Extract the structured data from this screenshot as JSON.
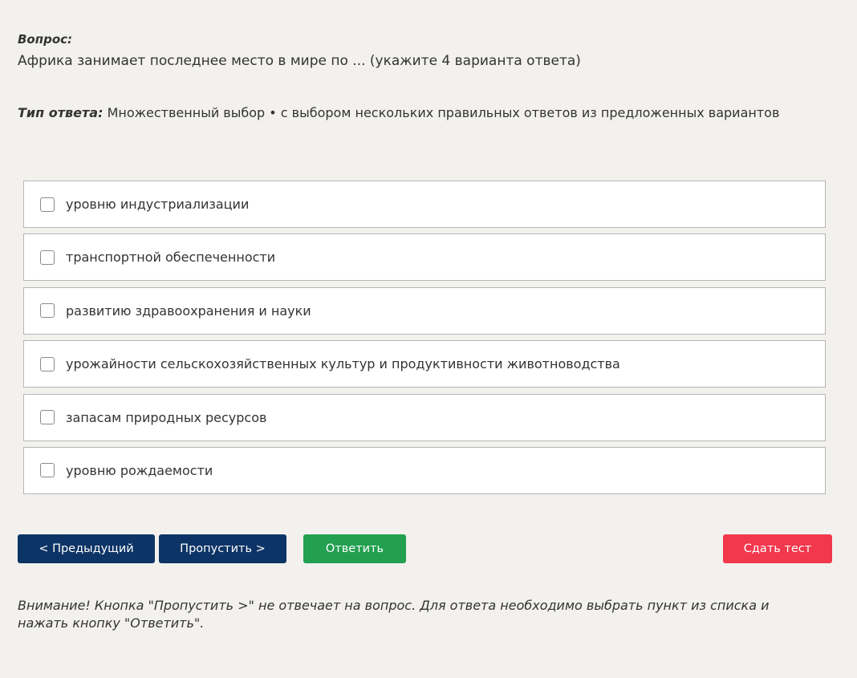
{
  "question": {
    "label": "Вопрос:",
    "text": "Африка занимает последнее место в мире по ... (укажите 4 варианта ответа)"
  },
  "answer_type": {
    "label": "Тип ответа:",
    "value": "Множественный выбор • с выбором нескольких правильных ответов из предложенных вариантов"
  },
  "options": [
    {
      "label": "уровню индустриализации",
      "checked": false
    },
    {
      "label": "транспортной обеспеченности",
      "checked": false
    },
    {
      "label": "развитию здравоохранения и науки",
      "checked": false
    },
    {
      "label": "урожайности сельскохозяйственных культур и продуктивности животноводства",
      "checked": false
    },
    {
      "label": "запасам природных ресурсов",
      "checked": false
    },
    {
      "label": "уровню рождаемости",
      "checked": false
    }
  ],
  "buttons": {
    "prev_label": "< Предыдущий",
    "skip_label": "Пропустить >",
    "answer_label": "Ответить",
    "finish_label": "Сдать тест"
  },
  "colors": {
    "background": "#f2f1ee",
    "nav_button": "#0d3466",
    "answer_button": "#22a050",
    "finish_button": "#f2384d"
  },
  "notice": "Внимание! Кнопка \"Пропустить >\" не отвечает на вопрос. Для ответа необходимо выбрать пункт из списка и нажать кнопку \"Ответить\"."
}
